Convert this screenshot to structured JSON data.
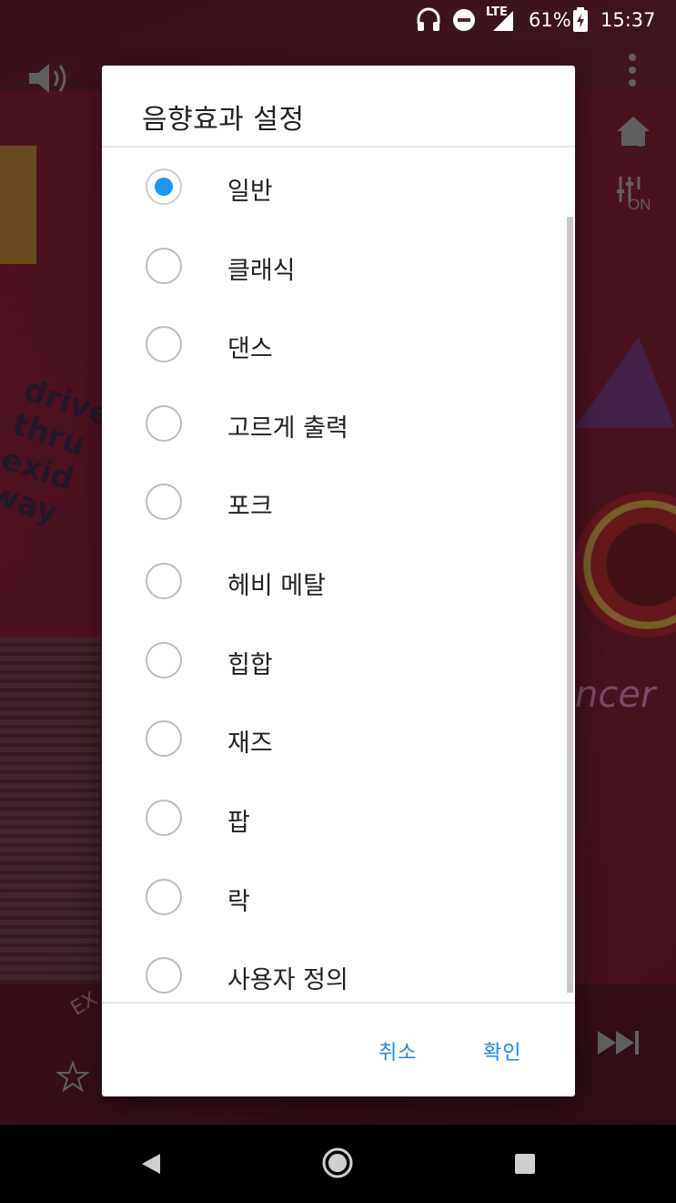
{
  "status_bar": {
    "network": "LTE",
    "battery": "61%",
    "time": "15:37"
  },
  "background_app": {
    "partial_text": "EX"
  },
  "dialog": {
    "title": "음향효과 설정",
    "selected_index": 0,
    "options": [
      {
        "label": "일반",
        "checked": true
      },
      {
        "label": "클래식",
        "checked": false
      },
      {
        "label": "댄스",
        "checked": false
      },
      {
        "label": "고르게 출력",
        "checked": false
      },
      {
        "label": "포크",
        "checked": false
      },
      {
        "label": "헤비 메탈",
        "checked": false
      },
      {
        "label": "힙합",
        "checked": false
      },
      {
        "label": "재즈",
        "checked": false
      },
      {
        "label": "팝",
        "checked": false
      },
      {
        "label": "락",
        "checked": false
      },
      {
        "label": "사용자 정의",
        "checked": false
      }
    ],
    "cancel_label": "취소",
    "confirm_label": "확인"
  },
  "colors": {
    "accent": "#2196f3",
    "button_text": "#1e88e5",
    "scrim": "rgba(0,0,0,0.38)"
  },
  "icons": {
    "status": [
      "headphones-icon",
      "do-not-disturb-icon",
      "signal-icon",
      "battery-charging-icon"
    ],
    "background": [
      "volume-icon",
      "more-vert-icon",
      "home-music-icon",
      "equalizer-on-icon",
      "next-track-icon",
      "star-icon"
    ],
    "nav": [
      "back-icon",
      "home-icon",
      "recents-icon"
    ]
  }
}
